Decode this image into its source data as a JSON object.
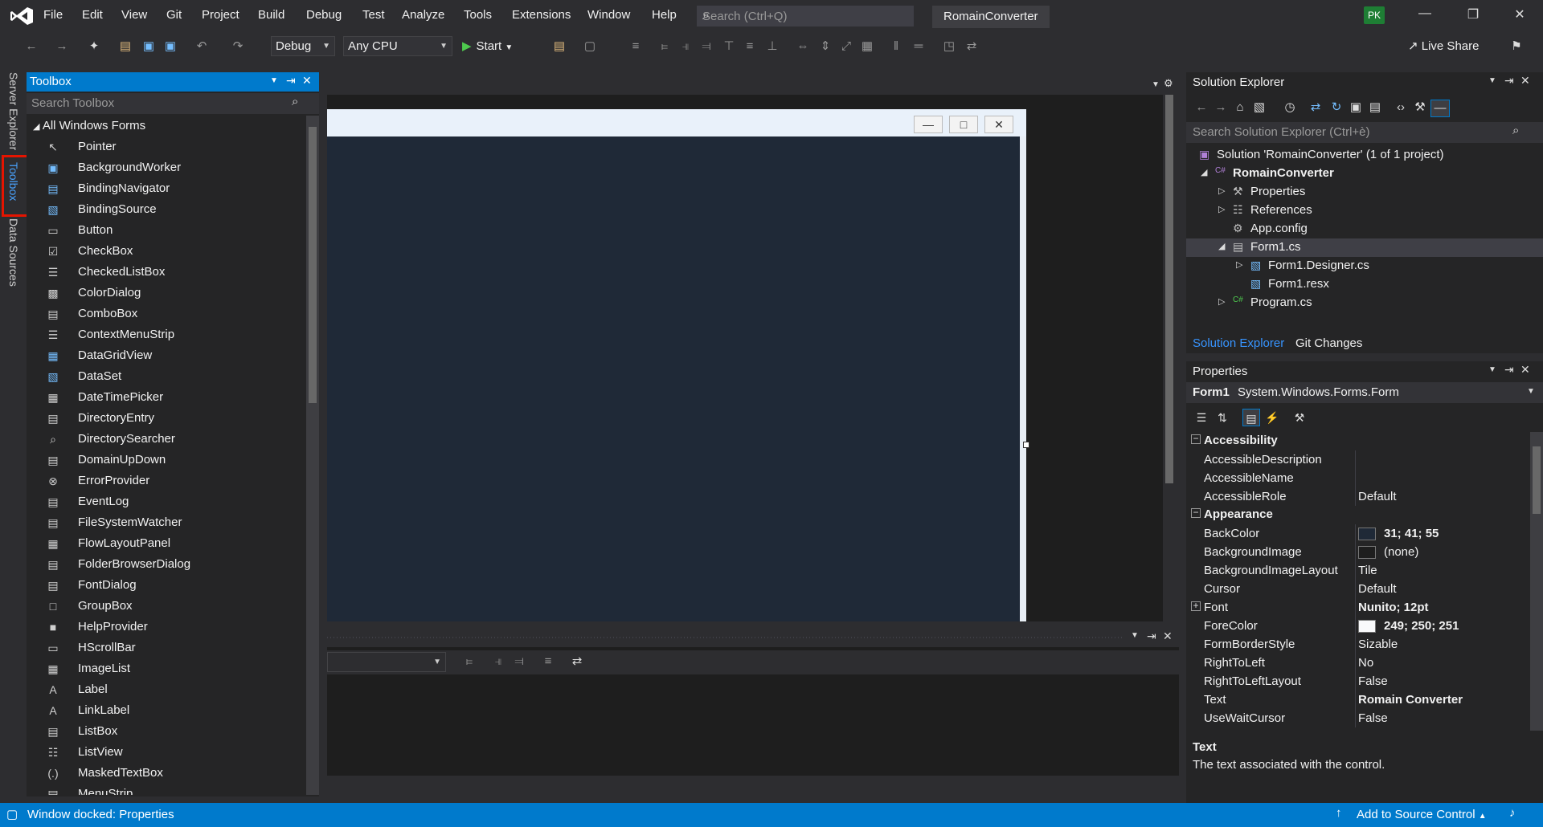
{
  "menu": [
    "File",
    "Edit",
    "View",
    "Git",
    "Project",
    "Build",
    "Debug",
    "Test",
    "Analyze",
    "Tools",
    "Extensions",
    "Window",
    "Help"
  ],
  "search": {
    "placeholder": "Search (Ctrl+Q)"
  },
  "solution_name": "RomainConverter",
  "avatar": "PK",
  "toolbar": {
    "config": "Debug",
    "platform": "Any CPU",
    "start": "Start",
    "live_share": "Live Share"
  },
  "left_tabs": {
    "server_explorer": "Server Explorer",
    "toolbox": "Toolbox",
    "data_sources": "Data Sources"
  },
  "toolbox": {
    "title": "Toolbox",
    "search_placeholder": "Search Toolbox",
    "group": "All Windows Forms",
    "items": [
      {
        "label": "Pointer",
        "icon": "pointer-icon"
      },
      {
        "label": "BackgroundWorker",
        "icon": "backgroundworker-icon"
      },
      {
        "label": "BindingNavigator",
        "icon": "bindingnavigator-icon"
      },
      {
        "label": "BindingSource",
        "icon": "bindingsource-icon"
      },
      {
        "label": "Button",
        "icon": "button-icon"
      },
      {
        "label": "CheckBox",
        "icon": "checkbox-icon"
      },
      {
        "label": "CheckedListBox",
        "icon": "checkedlistbox-icon"
      },
      {
        "label": "ColorDialog",
        "icon": "colordialog-icon"
      },
      {
        "label": "ComboBox",
        "icon": "combobox-icon"
      },
      {
        "label": "ContextMenuStrip",
        "icon": "contextmenustrip-icon"
      },
      {
        "label": "DataGridView",
        "icon": "datagridview-icon"
      },
      {
        "label": "DataSet",
        "icon": "dataset-icon"
      },
      {
        "label": "DateTimePicker",
        "icon": "datetimepicker-icon"
      },
      {
        "label": "DirectoryEntry",
        "icon": "directoryentry-icon"
      },
      {
        "label": "DirectorySearcher",
        "icon": "directorysearcher-icon"
      },
      {
        "label": "DomainUpDown",
        "icon": "domainupdown-icon"
      },
      {
        "label": "ErrorProvider",
        "icon": "errorprovider-icon"
      },
      {
        "label": "EventLog",
        "icon": "eventlog-icon"
      },
      {
        "label": "FileSystemWatcher",
        "icon": "filesystemwatcher-icon"
      },
      {
        "label": "FlowLayoutPanel",
        "icon": "flowlayoutpanel-icon"
      },
      {
        "label": "FolderBrowserDialog",
        "icon": "folderbrowserdialog-icon"
      },
      {
        "label": "FontDialog",
        "icon": "fontdialog-icon"
      },
      {
        "label": "GroupBox",
        "icon": "groupbox-icon"
      },
      {
        "label": "HelpProvider",
        "icon": "helpprovider-icon"
      },
      {
        "label": "HScrollBar",
        "icon": "hscrollbar-icon"
      },
      {
        "label": "ImageList",
        "icon": "imagelist-icon"
      },
      {
        "label": "Label",
        "icon": "label-icon"
      },
      {
        "label": "LinkLabel",
        "icon": "linklabel-icon"
      },
      {
        "label": "ListBox",
        "icon": "listbox-icon"
      },
      {
        "label": "ListView",
        "icon": "listview-icon"
      },
      {
        "label": "MaskedTextBox",
        "icon": "maskedtextbox-icon"
      },
      {
        "label": "MenuStrip",
        "icon": "menustrip-icon"
      }
    ]
  },
  "solution_explorer": {
    "title": "Solution Explorer",
    "search_placeholder": "Search Solution Explorer (Ctrl+è)",
    "nodes": [
      {
        "label": "Solution 'RomainConverter' (1 of 1 project)",
        "icon": "solution-icon"
      },
      {
        "label": "RomainConverter",
        "icon": "csharp-project-icon"
      },
      {
        "label": "Properties",
        "icon": "wrench-icon"
      },
      {
        "label": "References",
        "icon": "references-icon"
      },
      {
        "label": "App.config",
        "icon": "config-file-icon"
      },
      {
        "label": "Form1.cs",
        "icon": "form-icon"
      },
      {
        "label": "Form1.Designer.cs",
        "icon": "cs-file-icon"
      },
      {
        "label": "Form1.resx",
        "icon": "resx-file-icon"
      },
      {
        "label": "Program.cs",
        "icon": "csharp-file-icon"
      }
    ],
    "tabs": [
      "Solution Explorer",
      "Git Changes"
    ]
  },
  "properties": {
    "title": "Properties",
    "object_name": "Form1",
    "object_type": "System.Windows.Forms.Form",
    "categories": [
      {
        "name": "Accessibility",
        "rows": [
          {
            "name": "AccessibleDescription",
            "value": ""
          },
          {
            "name": "AccessibleName",
            "value": ""
          },
          {
            "name": "AccessibleRole",
            "value": "Default"
          }
        ]
      },
      {
        "name": "Appearance",
        "rows": [
          {
            "name": "BackColor",
            "value": "31; 41; 55",
            "swatch": "#1f2937",
            "bold": true
          },
          {
            "name": "BackgroundImage",
            "value": "(none)",
            "swatch": "#1e1e1e"
          },
          {
            "name": "BackgroundImageLayout",
            "value": "Tile"
          },
          {
            "name": "Cursor",
            "value": "Default"
          },
          {
            "name": "Font",
            "value": "Nunito; 12pt",
            "bold": true
          },
          {
            "name": "ForeColor",
            "value": "249; 250; 251",
            "swatch": "#f9fafb",
            "bold": true
          },
          {
            "name": "FormBorderStyle",
            "value": "Sizable"
          },
          {
            "name": "RightToLeft",
            "value": "No"
          },
          {
            "name": "RightToLeftLayout",
            "value": "False"
          },
          {
            "name": "Text",
            "value": "Romain Converter",
            "bold": true
          },
          {
            "name": "UseWaitCursor",
            "value": "False"
          }
        ]
      }
    ],
    "description_title": "Text",
    "description": "The text associated with the control."
  },
  "status": {
    "left": "Window docked: Properties",
    "right": "Add to Source Control"
  },
  "colors": {
    "accent": "#007acc",
    "form_back": "#1f2937",
    "bg": "#2d2d30",
    "highlight": "#e51400"
  }
}
